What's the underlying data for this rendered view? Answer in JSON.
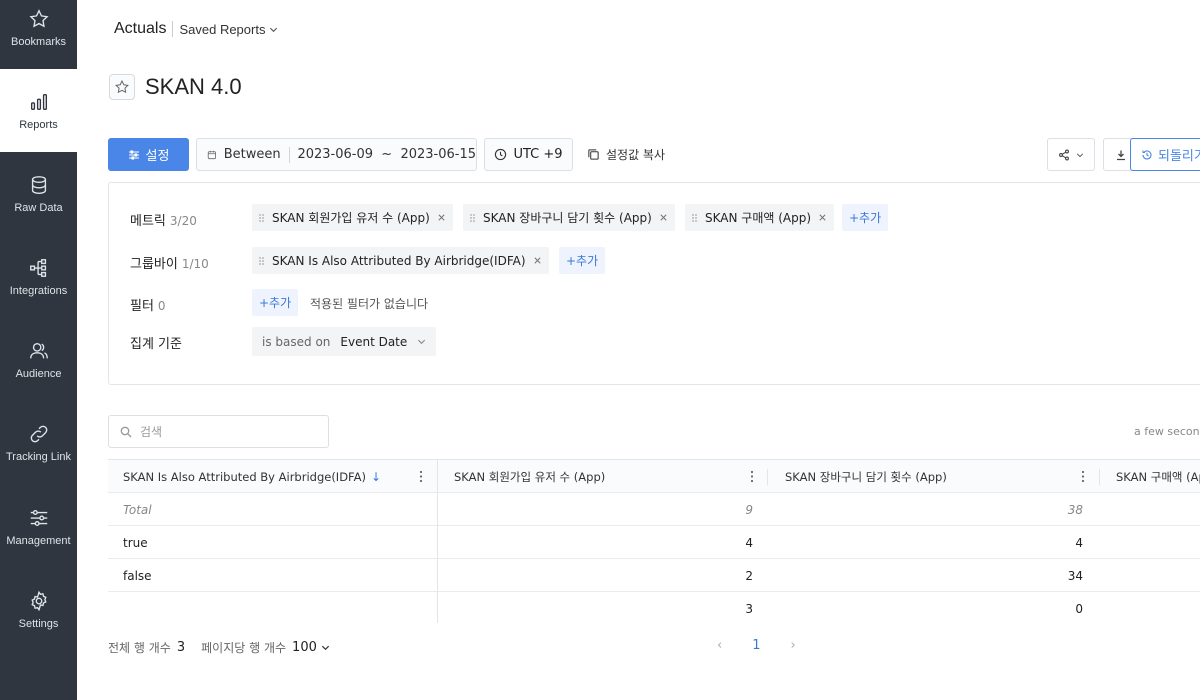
{
  "sidebar": {
    "items": [
      {
        "label": "Bookmarks",
        "icon": "star-icon"
      },
      {
        "label": "Reports",
        "icon": "bar-chart-icon",
        "active": true
      },
      {
        "label": "Raw Data",
        "icon": "database-icon"
      },
      {
        "label": "Integrations",
        "icon": "integrations-icon"
      },
      {
        "label": "Audience",
        "icon": "users-icon"
      },
      {
        "label": "Tracking Link",
        "icon": "link-icon"
      },
      {
        "label": "Management",
        "icon": "sliders-icon"
      },
      {
        "label": "Settings",
        "icon": "gear-icon"
      }
    ]
  },
  "breadcrumb": {
    "title": "Actuals",
    "saved_reports": "Saved Reports"
  },
  "page": {
    "title": "SKAN 4.0"
  },
  "toolbar": {
    "settings_label": "설정",
    "date_prefix": "Between",
    "date_range": "2023-06-09  ~  2023-06-15",
    "timezone": "UTC +9",
    "copy_settings": "설정값 복사",
    "more": "···",
    "revert": "되돌리기"
  },
  "config": {
    "metrics": {
      "label": "메트릭",
      "count": "3/20",
      "items": [
        "SKAN 회원가입 유저 수 (App)",
        "SKAN 장바구니 담기 횟수 (App)",
        "SKAN 구매액 (App)"
      ],
      "add": "+추가"
    },
    "groupby": {
      "label": "그룹바이",
      "count": "1/10",
      "items": [
        "SKAN Is Also Attributed By Airbridge(IDFA)"
      ],
      "add": "+추가"
    },
    "filter": {
      "label": "필터",
      "count": "0",
      "add": "+추가",
      "empty": "적용된 필터가 없습니다"
    },
    "aggregation": {
      "label": "집계 기준",
      "prefix": "is based on",
      "value": "Event Date"
    }
  },
  "search": {
    "placeholder": "검색",
    "value": ""
  },
  "updated": "a few seconds ago",
  "table": {
    "columns": [
      "SKAN Is Also Attributed By Airbridge(IDFA)",
      "SKAN 회원가입 유저 수 (App)",
      "SKAN 장바구니 담기 횟수 (App)",
      "SKAN 구매액 (App)"
    ],
    "sort_indicator": "↓",
    "total": {
      "label": "Total",
      "values": [
        "9",
        "38"
      ]
    },
    "rows": [
      {
        "label": "true",
        "values": [
          "4",
          "4"
        ]
      },
      {
        "label": "false",
        "values": [
          "2",
          "34"
        ]
      },
      {
        "label": "",
        "values": [
          "3",
          "0"
        ]
      }
    ]
  },
  "footer": {
    "total_rows_label": "전체 행 개수",
    "total_rows": "3",
    "rows_per_page_label": "페이지당 행 개수",
    "rows_per_page": "100",
    "current_page": "1",
    "prev": "‹",
    "next": "›"
  },
  "colors": {
    "primary": "#4a86e8",
    "sidebar": "#2f3640",
    "link": "#3c78d8"
  }
}
